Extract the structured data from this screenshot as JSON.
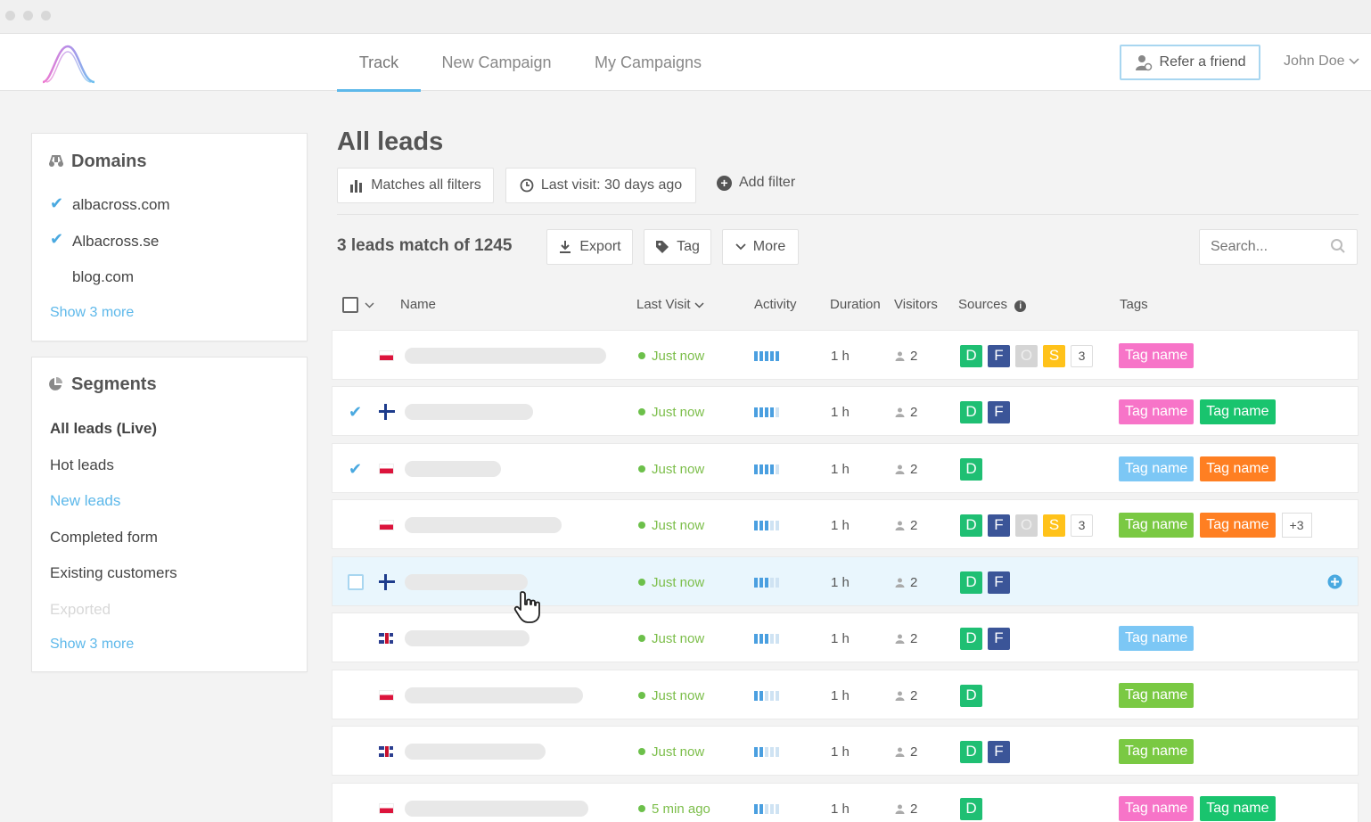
{
  "nav": {
    "tabs": [
      {
        "label": "Track",
        "active": true
      },
      {
        "label": "New Campaign",
        "active": false
      },
      {
        "label": "My Campaigns",
        "active": false
      }
    ],
    "refer_label": "Refer a friend",
    "user_name": "John Doe",
    "accent": "#5db8ea"
  },
  "domains": {
    "title": "Domains",
    "items": [
      {
        "label": "albacross.com",
        "checked": true
      },
      {
        "label": "Albacross.se",
        "checked": true
      },
      {
        "label": "blog.com",
        "checked": false
      }
    ],
    "show_more": "Show 3 more"
  },
  "segments": {
    "title": "Segments",
    "items": [
      {
        "label": "All leads (Live)",
        "state": "bold"
      },
      {
        "label": "Hot leads",
        "state": "normal"
      },
      {
        "label": "New leads",
        "state": "active"
      },
      {
        "label": "Completed form",
        "state": "normal"
      },
      {
        "label": "Existing customers",
        "state": "normal"
      },
      {
        "label": "Exported",
        "state": "disabled"
      }
    ],
    "show_more": "Show 3 more"
  },
  "main": {
    "title": "All leads",
    "filters": {
      "match": "Matches all filters",
      "last_visit": "Last visit: 30 days ago",
      "add": "Add filter"
    },
    "count": "3 leads match of 1245",
    "actions": {
      "export": "Export",
      "tag": "Tag",
      "more": "More"
    },
    "search_placeholder": "Search...",
    "columns": {
      "name": "Name",
      "last_visit": "Last Visit",
      "activity": "Activity",
      "duration": "Duration",
      "visitors": "Visitors",
      "sources": "Sources",
      "tags": "Tags"
    },
    "rows": [
      {
        "selected": false,
        "flag": "pl",
        "visit": "Just now",
        "activity": 5,
        "duration": "1 h",
        "visitors": "2",
        "sources": [
          "D",
          "F",
          "O",
          "S"
        ],
        "source_more": "3",
        "tags": [
          {
            "label": "Tag name",
            "color": "pink"
          }
        ],
        "tag_more": ""
      },
      {
        "selected": true,
        "flag": "fi",
        "visit": "Just now",
        "activity": 4,
        "duration": "1 h",
        "visitors": "2",
        "sources": [
          "D",
          "F"
        ],
        "source_more": "",
        "tags": [
          {
            "label": "Tag name",
            "color": "pink"
          },
          {
            "label": "Tag name",
            "color": "green"
          }
        ],
        "tag_more": ""
      },
      {
        "selected": true,
        "flag": "pl",
        "visit": "Just now",
        "activity": 4,
        "duration": "1 h",
        "visitors": "2",
        "sources": [
          "D"
        ],
        "source_more": "",
        "tags": [
          {
            "label": "Tag name",
            "color": "blue"
          },
          {
            "label": "Tag name",
            "color": "orange"
          }
        ],
        "tag_more": ""
      },
      {
        "selected": false,
        "flag": "pl",
        "visit": "Just now",
        "activity": 3,
        "duration": "1 h",
        "visitors": "2",
        "sources": [
          "D",
          "F",
          "O",
          "S"
        ],
        "source_more": "3",
        "tags": [
          {
            "label": "Tag name",
            "color": "lime"
          },
          {
            "label": "Tag name",
            "color": "orange"
          }
        ],
        "tag_more": "+3"
      },
      {
        "selected": false,
        "hover": true,
        "flag": "fi",
        "visit": "Just now",
        "activity": 3,
        "duration": "1 h",
        "visitors": "2",
        "sources": [
          "D",
          "F"
        ],
        "source_more": "",
        "tags": [],
        "tag_more": ""
      },
      {
        "selected": false,
        "flag": "gb",
        "visit": "Just now",
        "activity": 3,
        "duration": "1 h",
        "visitors": "2",
        "sources": [
          "D",
          "F"
        ],
        "source_more": "",
        "tags": [
          {
            "label": "Tag name",
            "color": "blue"
          }
        ],
        "tag_more": ""
      },
      {
        "selected": false,
        "flag": "pl",
        "visit": "Just now",
        "activity": 2,
        "duration": "1 h",
        "visitors": "2",
        "sources": [
          "D"
        ],
        "source_more": "",
        "tags": [
          {
            "label": "Tag name",
            "color": "lime"
          }
        ],
        "tag_more": ""
      },
      {
        "selected": false,
        "flag": "gb",
        "visit": "Just now",
        "activity": 2,
        "duration": "1 h",
        "visitors": "2",
        "sources": [
          "D",
          "F"
        ],
        "source_more": "",
        "tags": [
          {
            "label": "Tag name",
            "color": "lime"
          }
        ],
        "tag_more": ""
      },
      {
        "selected": false,
        "flag": "pl",
        "visit": "5 min ago",
        "activity": 2,
        "duration": "1 h",
        "visitors": "2",
        "sources": [
          "D"
        ],
        "source_more": "",
        "tags": [
          {
            "label": "Tag name",
            "color": "pink"
          },
          {
            "label": "Tag name",
            "color": "green"
          }
        ],
        "tag_more": ""
      }
    ]
  }
}
